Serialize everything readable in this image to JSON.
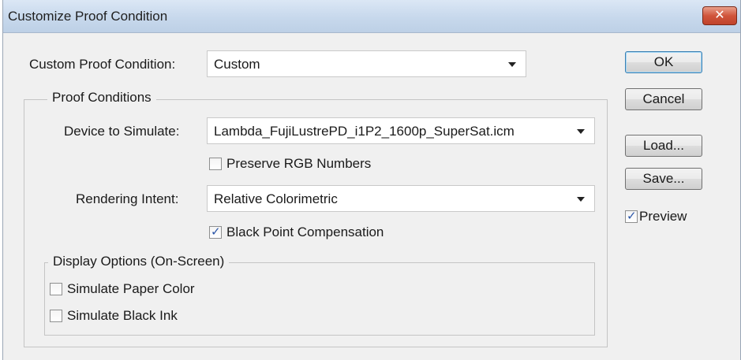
{
  "window": {
    "title": "Customize Proof Condition"
  },
  "custom_condition": {
    "label": "Custom Proof Condition:",
    "value": "Custom"
  },
  "proof_conditions": {
    "legend": "Proof Conditions",
    "device": {
      "label": "Device to Simulate:",
      "value": "Lambda_FujiLustrePD_i1P2_1600p_SuperSat.icm"
    },
    "preserve_rgb": {
      "label": "Preserve RGB Numbers",
      "checked": false
    },
    "rendering": {
      "label": "Rendering Intent:",
      "value": "Relative Colorimetric"
    },
    "black_point": {
      "label": "Black Point Compensation",
      "checked": true
    },
    "display_options": {
      "legend": "Display Options (On-Screen)",
      "paper_color": {
        "label": "Simulate Paper Color",
        "checked": false
      },
      "black_ink": {
        "label": "Simulate Black Ink",
        "checked": false
      }
    }
  },
  "buttons": {
    "ok": "OK",
    "cancel": "Cancel",
    "load": "Load...",
    "save": "Save..."
  },
  "preview": {
    "label": "Preview",
    "checked": true
  },
  "colors": {
    "titlebar": "#c7d8ec",
    "close": "#c7432b",
    "dialog_bg": "#f0f0f0",
    "check": "#2a55a8"
  }
}
